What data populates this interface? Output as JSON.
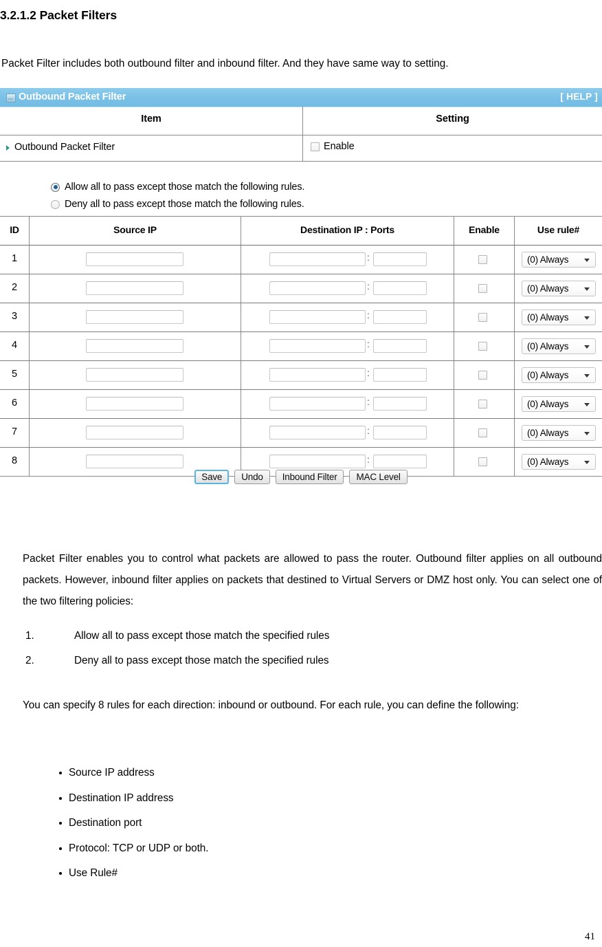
{
  "document": {
    "heading": "3.2.1.2 Packet Filters",
    "intro": "Packet Filter includes both outbound filter and inbound filter. And they have same way to setting.",
    "paragraph_1": "Packet Filter enables you to control what packets are allowed to pass the router. Outbound filter applies on all outbound packets. However, inbound filter applies on packets that destined to Virtual Servers or DMZ host only. You can select one of the two filtering policies:",
    "numbered_list": [
      {
        "num": "1.",
        "text": "Allow all to pass except those match the specified rules"
      },
      {
        "num": "2.",
        "text": "Deny all to pass except those match the specified rules"
      }
    ],
    "paragraph_2": "You can specify 8 rules for each direction: inbound or outbound. For each rule, you can define the following:",
    "bullet_list": [
      "Source IP address",
      "Destination IP address",
      "Destination port",
      "Protocol: TCP or UDP or both.",
      "Use Rule#"
    ],
    "page_number": "41"
  },
  "panel": {
    "title": "Outbound Packet Filter",
    "title_icon": "window-icon",
    "help_label": "[ HELP ]",
    "header_color": "#7ec3e8",
    "item_table": {
      "headers": [
        "Item",
        "Setting"
      ],
      "rows": [
        {
          "label": "Outbound Packet Filter",
          "checkbox_label": "Enable",
          "checked": false
        }
      ]
    },
    "policy": {
      "options": [
        {
          "label": "Allow all to pass except those match the following rules.",
          "selected": true
        },
        {
          "label": "Deny all to pass except those match the following rules.",
          "selected": false
        }
      ]
    },
    "rules_table": {
      "headers": [
        "ID",
        "Source IP",
        "Destination IP : Ports",
        "Enable",
        "Use rule#"
      ],
      "separator": ":",
      "rule_select_value": "(0) Always",
      "rows": [
        {
          "id": "1",
          "source_ip": "",
          "dest_ip": "",
          "dest_port": "",
          "enable": false,
          "use_rule": "(0) Always"
        },
        {
          "id": "2",
          "source_ip": "",
          "dest_ip": "",
          "dest_port": "",
          "enable": false,
          "use_rule": "(0) Always"
        },
        {
          "id": "3",
          "source_ip": "",
          "dest_ip": "",
          "dest_port": "",
          "enable": false,
          "use_rule": "(0) Always"
        },
        {
          "id": "4",
          "source_ip": "",
          "dest_ip": "",
          "dest_port": "",
          "enable": false,
          "use_rule": "(0) Always"
        },
        {
          "id": "5",
          "source_ip": "",
          "dest_ip": "",
          "dest_port": "",
          "enable": false,
          "use_rule": "(0) Always"
        },
        {
          "id": "6",
          "source_ip": "",
          "dest_ip": "",
          "dest_port": "",
          "enable": false,
          "use_rule": "(0) Always"
        },
        {
          "id": "7",
          "source_ip": "",
          "dest_ip": "",
          "dest_port": "",
          "enable": false,
          "use_rule": "(0) Always"
        },
        {
          "id": "8",
          "source_ip": "",
          "dest_ip": "",
          "dest_port": "",
          "enable": false,
          "use_rule": "(0) Always"
        }
      ]
    },
    "buttons": [
      {
        "label": "Save",
        "primary": true
      },
      {
        "label": "Undo",
        "primary": false
      },
      {
        "label": "Inbound Filter",
        "primary": false
      },
      {
        "label": "MAC Level",
        "primary": false
      }
    ]
  }
}
